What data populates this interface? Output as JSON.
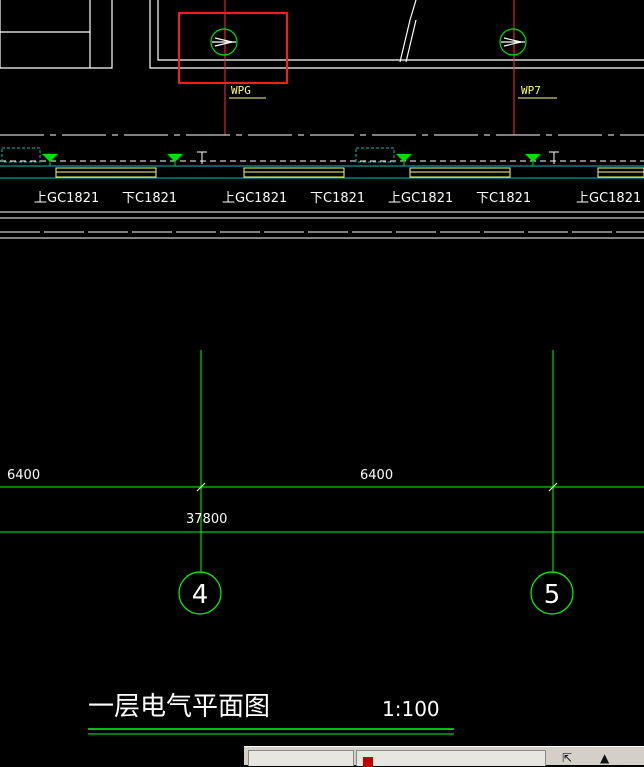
{
  "drawing": {
    "title": "一层电气平面图",
    "scale": "1:100",
    "circuits": [
      "WPG",
      "WP7"
    ],
    "window_labels": [
      "上GC1821",
      "下C1821",
      "上GC1821",
      "下C1821",
      "上GC1821",
      "下C1821",
      "上GC1821"
    ],
    "dimensions": {
      "bay_left": "6400",
      "bay_right": "6400",
      "overall": "37800"
    },
    "grid_axes": [
      "4",
      "5"
    ]
  },
  "colors": {
    "background": "#000000",
    "grid_line": "#00ff00",
    "wall": "#ffffff",
    "circuit_line": "#ff3030",
    "circuit_label": "#ffff66",
    "highlight_box": "#ff1a1a",
    "fixture": "#00e000",
    "dim_text": "#ffffff"
  },
  "taskbar": {
    "tab_count": 2
  }
}
